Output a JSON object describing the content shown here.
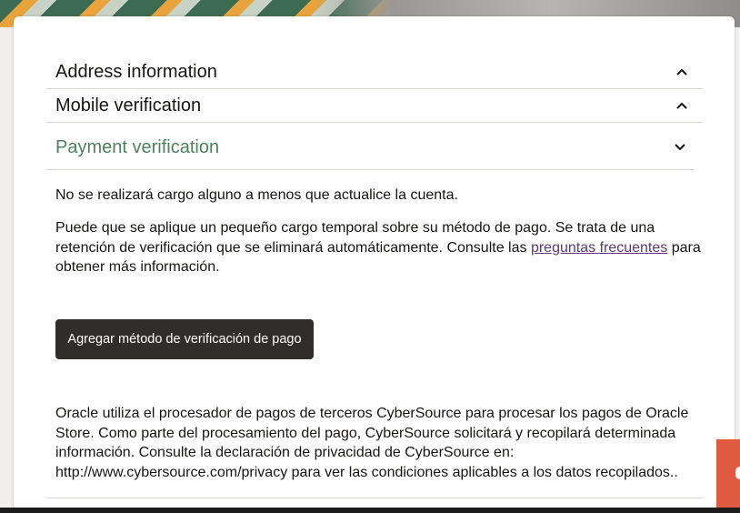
{
  "sections": {
    "address": {
      "title": "Address information",
      "chevron_icon": "chevron-up-icon"
    },
    "mobile": {
      "title": "Mobile verification",
      "chevron_icon": "chevron-up-icon"
    },
    "payment": {
      "title": "Payment verification",
      "chevron_icon": "chevron-down-icon"
    }
  },
  "payment": {
    "no_charge_text": "No se realizará cargo alguno a menos que actualice la cuenta.",
    "hold_text_part1": "Puede que se aplique un pequeño cargo temporal sobre su método de pago. Se trata de una retención de verificación que se eliminará automáticamente. Consulte las ",
    "faq_link": "preguntas frecuentes",
    "hold_text_part2": " para obtener más información.",
    "add_button_label": "Agregar método de verificación de pago",
    "processor_text": "Oracle utiliza el procesador de pagos de terceros CyberSource para procesar los pagos de Oracle Store. Como parte del procesamiento del pago, CyberSource solicitará y recopilará determinada información. Consulte la declaración de privacidad de CyberSource en: http://www.cybersource.com/privacy para ver las condiciones aplicables a los datos recopilados.."
  },
  "colors": {
    "active_section": "#4c825c",
    "button_bg": "#312d2a",
    "link": "#5f3a78",
    "feedback_tab": "#e05a41"
  }
}
